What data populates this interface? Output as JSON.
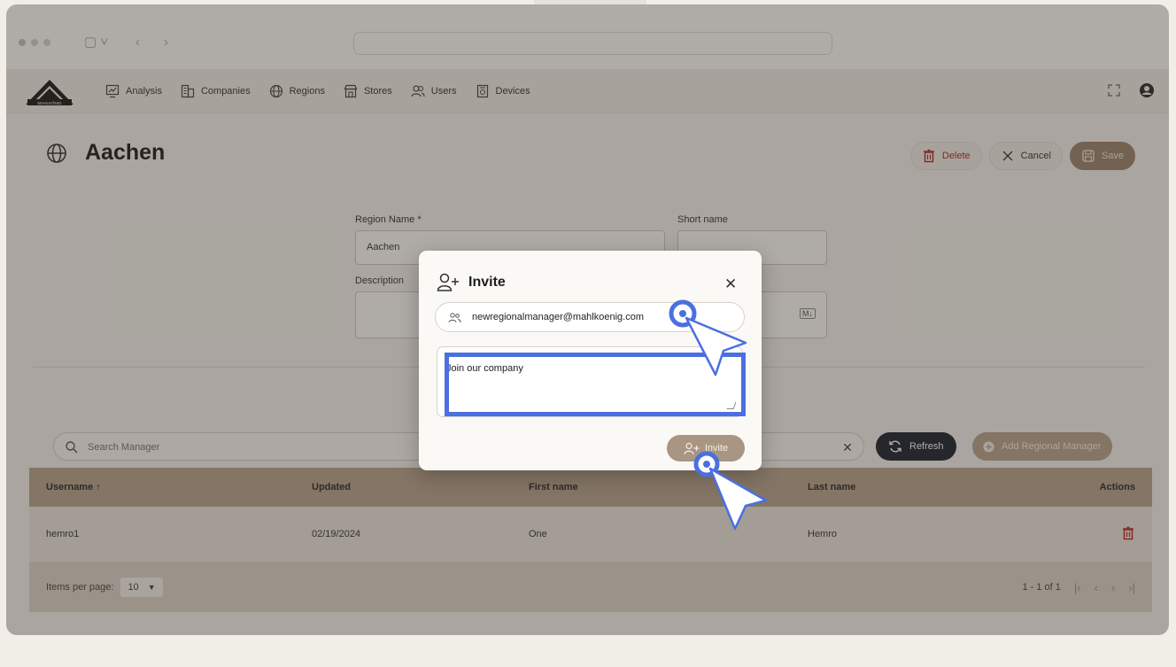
{
  "nav": {
    "items": [
      {
        "label": "Analysis",
        "icon": "chart-icon"
      },
      {
        "label": "Companies",
        "icon": "building-icon"
      },
      {
        "label": "Regions",
        "icon": "globe-icon"
      },
      {
        "label": "Stores",
        "icon": "store-icon"
      },
      {
        "label": "Users",
        "icon": "users-icon"
      },
      {
        "label": "Devices",
        "icon": "device-icon"
      }
    ],
    "logo_text": "MAHLKÖNIG"
  },
  "page": {
    "title": "Aachen",
    "delete_label": "Delete",
    "cancel_label": "Cancel",
    "save_label": "Save"
  },
  "form": {
    "region_name_label": "Region Name *",
    "region_name_value": "Aachen",
    "short_name_label": "Short name",
    "short_name_value": "",
    "description_label": "Description",
    "markdown_badge": "M↓"
  },
  "managers": {
    "search_placeholder": "Search Manager",
    "refresh_label": "Refresh",
    "add_label": "Add Regional Manager",
    "columns": [
      "Username ↑",
      "Updated",
      "First name",
      "Last name",
      "Actions"
    ],
    "rows": [
      {
        "username": "hemro1",
        "updated": "02/19/2024",
        "first_name": "One",
        "last_name": "Hemro"
      }
    ],
    "items_per_page_label": "Items per page:",
    "items_per_page_value": "10",
    "range_label": "1 - 1 of 1"
  },
  "dialog": {
    "title": "Invite",
    "email_value": "newregionalmanager@mahlkoenig.com",
    "message_value": "Join our company",
    "invite_label": "Invite"
  },
  "colors": {
    "accent": "#b8a691",
    "dark_button": "#1a2433",
    "delete_red": "#b3262a",
    "highlight_blue": "#4b6fe0"
  }
}
